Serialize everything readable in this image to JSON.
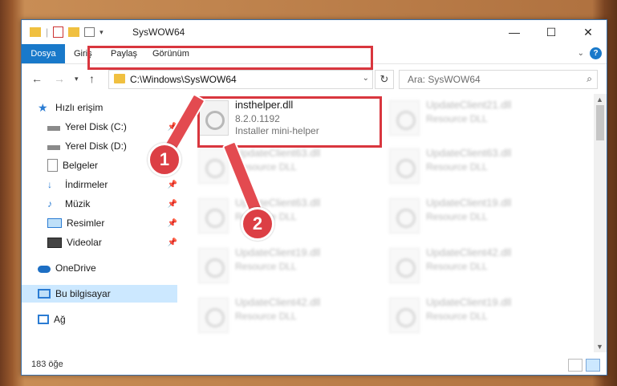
{
  "window": {
    "title": "SysWOW64"
  },
  "ribbon": {
    "tabs": [
      "Dosya",
      "Giriş",
      "Paylaş",
      "Görünüm"
    ],
    "help": "?"
  },
  "nav": {
    "address": "C:\\Windows\\SysWOW64",
    "search_placeholder": "Ara: SysWOW64"
  },
  "sidebar": {
    "items": [
      {
        "label": "Hızlı erişim"
      },
      {
        "label": "Yerel Disk (C:)"
      },
      {
        "label": "Yerel Disk (D:)"
      },
      {
        "label": "Belgeler"
      },
      {
        "label": "İndirmeler"
      },
      {
        "label": "Müzik"
      },
      {
        "label": "Resimler"
      },
      {
        "label": "Videolar"
      },
      {
        "label": "OneDrive"
      },
      {
        "label": "Bu bilgisayar"
      },
      {
        "label": "Ağ"
      }
    ]
  },
  "files": [
    {
      "name": "insthelper.dll",
      "version": "8.2.0.1192",
      "description": "Installer mini-helper"
    },
    {
      "name": "UpdateClient21.dll",
      "description": "Resource DLL"
    },
    {
      "name": "UpdateClient63.dll",
      "description": "Resource DLL"
    },
    {
      "name": "UpdateClient63.dll",
      "description": "Resource DLL"
    },
    {
      "name": "UpdateClient63.dll",
      "description": "Resource DLL"
    },
    {
      "name": "UpdateClient19.dll",
      "description": "Resource DLL"
    },
    {
      "name": "UpdateClient19.dll",
      "description": "Resource DLL"
    },
    {
      "name": "UpdateClient42.dll",
      "description": "Resource DLL"
    },
    {
      "name": "UpdateClient42.dll",
      "description": "Resource DLL"
    },
    {
      "name": "UpdateClient19.dll",
      "description": "Resource DLL"
    }
  ],
  "status": {
    "count": "183 öğe"
  },
  "callouts": [
    "1",
    "2"
  ],
  "colors": {
    "accent": "#1979ca",
    "highlight": "#d9363e",
    "selected": "#cce8ff"
  }
}
